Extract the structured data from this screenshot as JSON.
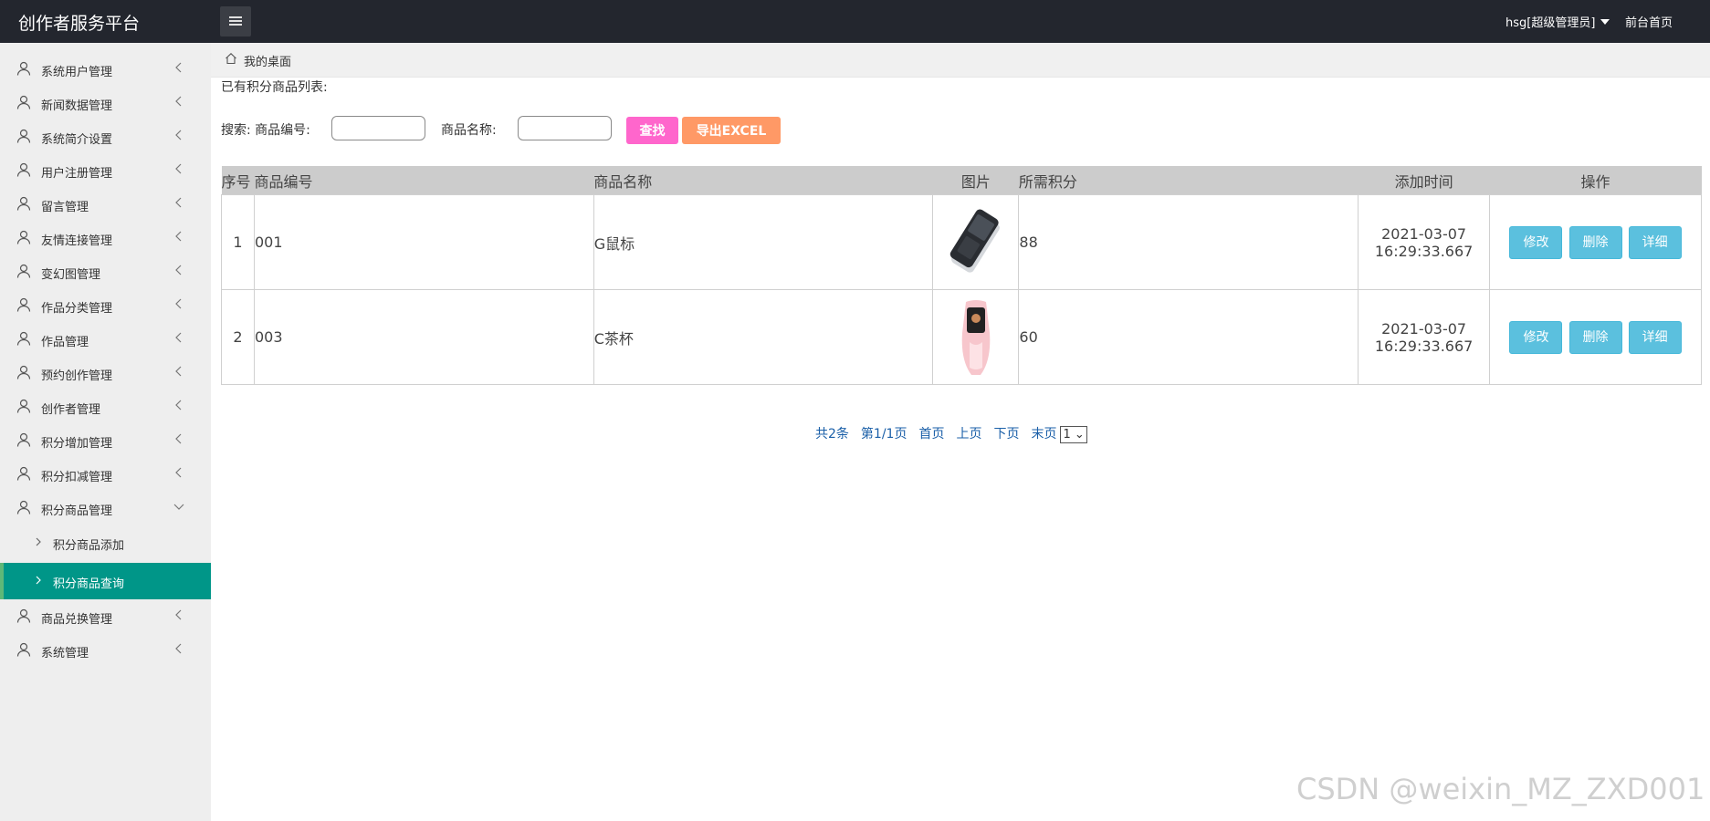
{
  "app": {
    "title": "创作者服务平台",
    "user": "hsg[超级管理员]",
    "front_page": "前台首页"
  },
  "sidebar": {
    "items": [
      {
        "label": "系统用户管理"
      },
      {
        "label": "新闻数据管理"
      },
      {
        "label": "系统简介设置"
      },
      {
        "label": "用户注册管理"
      },
      {
        "label": "留言管理"
      },
      {
        "label": "友情连接管理"
      },
      {
        "label": "变幻图管理"
      },
      {
        "label": "作品分类管理"
      },
      {
        "label": "作品管理"
      },
      {
        "label": "预约创作管理"
      },
      {
        "label": "创作者管理"
      },
      {
        "label": "积分增加管理"
      },
      {
        "label": "积分扣减管理"
      },
      {
        "label": "积分商品管理"
      }
    ],
    "sub_items": [
      {
        "label": "积分商品添加"
      },
      {
        "label": "积分商品查询"
      }
    ],
    "after_items": [
      {
        "label": "商品兑换管理"
      },
      {
        "label": "系统管理"
      }
    ]
  },
  "breadcrumb": {
    "label": "我的桌面"
  },
  "main": {
    "list_title": "已有积分商品列表:",
    "search_label": "搜索: 商品编号:",
    "name_label": "商品名称:",
    "find_button": "查找",
    "export_button": "导出EXCEL"
  },
  "table": {
    "headers": [
      "序号",
      "商品编号",
      "商品名称",
      "图片",
      "所需积分",
      "添加时间",
      "操作"
    ],
    "rows": [
      {
        "index": "1",
        "code": "001",
        "name": "G鼠标",
        "points": "88",
        "time": "2021-03-07 16:29:33.667"
      },
      {
        "index": "2",
        "code": "003",
        "name": "C茶杯",
        "points": "60",
        "time": "2021-03-07 16:29:33.667"
      }
    ],
    "actions": {
      "edit": "修改",
      "delete": "删除",
      "detail": "详细"
    }
  },
  "pagination": {
    "total": "共2条",
    "page": "第1/1页",
    "first": "首页",
    "prev": "上页",
    "next": "下页",
    "last": "末页",
    "select": "1"
  },
  "watermark": "CSDN @weixin_MZ_ZXD001",
  "colors": {
    "topbar": "#23262e",
    "sidebar_active": "#009688",
    "find_button": "#ff66cc",
    "export_button": "#ff9966",
    "action_button": "#5bc0de"
  }
}
